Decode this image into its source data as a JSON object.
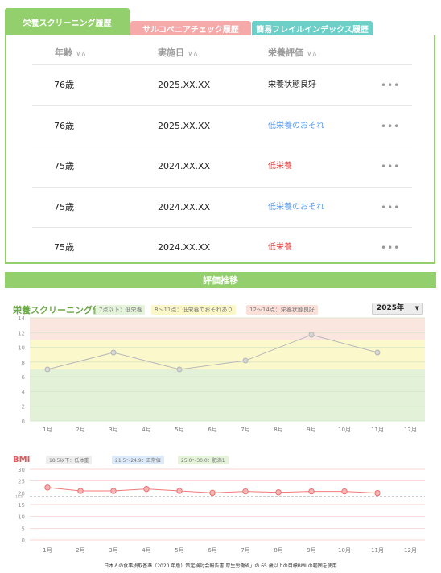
{
  "tabs": {
    "nutrition": "栄養スクリーニング履歴",
    "sarcopenia": "サルコペニアチェック履歴",
    "frailty": "簡易フレイルインデックス履歴"
  },
  "table": {
    "headers": {
      "age": "年齢",
      "date": "実施日",
      "evaluation": "栄養評価",
      "sort_icon": "∨∧"
    },
    "more_icon": "•••",
    "rows": [
      {
        "age": "76歳",
        "date": "2025.XX.XX",
        "evaluation": "栄養状態良好",
        "color": "#222222"
      },
      {
        "age": "76歳",
        "date": "2025.XX.XX",
        "evaluation": "低栄養のおそれ",
        "color": "#5b9bea"
      },
      {
        "age": "75歳",
        "date": "2024.XX.XX",
        "evaluation": "低栄養",
        "color": "#e54848"
      },
      {
        "age": "75歳",
        "date": "2024.XX.XX",
        "evaluation": "低栄養のおそれ",
        "color": "#5b9bea"
      },
      {
        "age": "75歳",
        "date": "2024.XX.XX",
        "evaluation": "低栄養",
        "color": "#e54848"
      }
    ]
  },
  "section_title": "評価推移",
  "screening_chart": {
    "title": "栄養スクリーニング値",
    "legend": [
      "7点以下：低栄養",
      "8〜11点：低栄養のおそれあり",
      "12〜14点：栄養状態良好"
    ],
    "year_select": "2025年"
  },
  "bmi_chart": {
    "title": "BMI",
    "legend": [
      "18.5以下：低体重",
      "21.5〜24.9：正常値",
      "25.0〜30.0：肥満1"
    ]
  },
  "footnote": "日本人の食事摂取基準（2020 年版）策定検討会報告書 厚生労働省」の 65 歳以上の目標BMI の範囲を使用",
  "chart_data": [
    {
      "type": "line",
      "title": "栄養スクリーニング値",
      "categories": [
        "1月",
        "2月",
        "3月",
        "4月",
        "5月",
        "6月",
        "7月",
        "8月",
        "9月",
        "10月",
        "11月",
        "12月"
      ],
      "series": [
        {
          "values": [
            7,
            null,
            9.3,
            null,
            7,
            null,
            8.2,
            null,
            11.7,
            null,
            9.3,
            null
          ]
        }
      ],
      "ylim": [
        0,
        14
      ],
      "yticks": [
        0,
        2,
        4,
        6,
        8,
        10,
        12,
        14
      ],
      "bands": [
        {
          "from": 0,
          "to": 7,
          "color": "#e3f1d9"
        },
        {
          "from": 7,
          "to": 11,
          "color": "#fbf8cc"
        },
        {
          "from": 11,
          "to": 14,
          "color": "#fbe5df"
        }
      ],
      "line_color": "#b8b8b8",
      "grid": true
    },
    {
      "type": "line",
      "title": "BMI",
      "categories": [
        "1月",
        "2月",
        "3月",
        "4月",
        "5月",
        "6月",
        "7月",
        "8月",
        "9月",
        "10月",
        "11月",
        "12月"
      ],
      "series": [
        {
          "values": [
            22.2,
            20.8,
            20.8,
            21.6,
            20.8,
            20.0,
            20.6,
            20.2,
            20.6,
            20.6,
            19.9,
            null
          ]
        }
      ],
      "ylim": [
        0,
        30
      ],
      "yticks": [
        0,
        5,
        10,
        15,
        20,
        25,
        30
      ],
      "reference_line": {
        "value": 18.5,
        "label": "18.5"
      },
      "line_color": "#f07a7a",
      "grid_color": "#f6c7c7",
      "grid": true
    }
  ]
}
